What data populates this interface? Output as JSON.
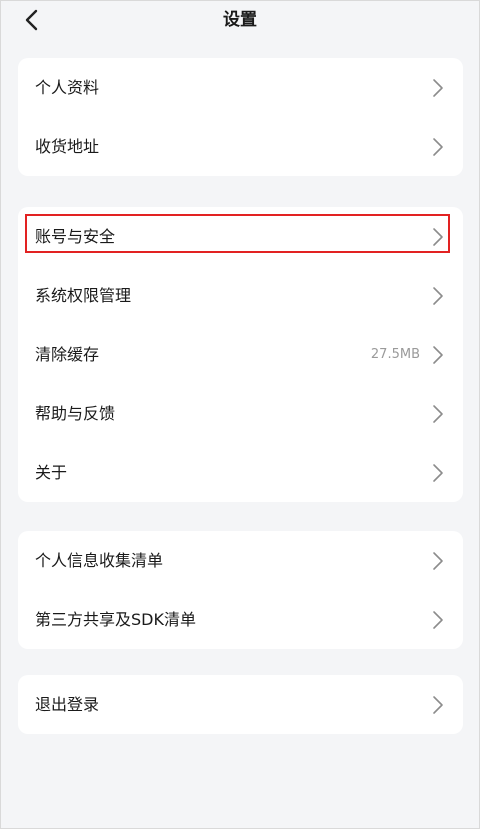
{
  "header": {
    "title": "设置"
  },
  "groups": [
    {
      "items": [
        {
          "label": "个人资料"
        },
        {
          "label": "收货地址"
        }
      ]
    },
    {
      "items": [
        {
          "label": "账号与安全"
        },
        {
          "label": "系统权限管理"
        },
        {
          "label": "清除缓存",
          "value": "27.5MB"
        },
        {
          "label": "帮助与反馈"
        },
        {
          "label": "关于"
        }
      ]
    },
    {
      "items": [
        {
          "label": "个人信息收集清单"
        },
        {
          "label": "第三方共享及SDK清单"
        }
      ]
    },
    {
      "items": [
        {
          "label": "退出登录"
        }
      ]
    }
  ],
  "colors": {
    "background": "#f4f5f7",
    "card": "#ffffff",
    "highlight": "#e22222",
    "chevron": "#8c8c8c",
    "secondary_text": "#9a9a9a"
  },
  "icons": {
    "back": "chevron-left-icon",
    "row_arrow": "chevron-right-icon"
  }
}
